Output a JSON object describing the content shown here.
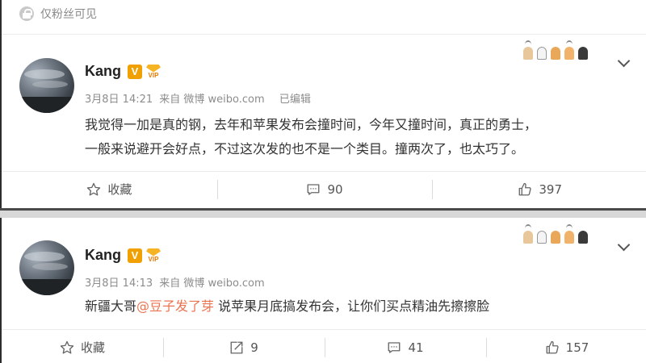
{
  "visibility": {
    "label": "仅粉丝可见"
  },
  "posts": [
    {
      "author": "Kang",
      "verified_badge": "V",
      "vip_badge": "VIP",
      "date": "3月8日 14:21",
      "source": "来自 微博 weibo.com",
      "edited": "已编辑",
      "text_line1": "我觉得一加是真的钢，去年和苹果发布会撞时间，今年又撞时间，真正的勇士，",
      "text_line2": "一般来说避开会好点，不过这次发的也不是一个类目。撞两次了，也太巧了。",
      "actions": {
        "favorite": "收藏",
        "comment": "90",
        "like": "397"
      }
    },
    {
      "author": "Kang",
      "verified_badge": "V",
      "vip_badge": "VIP",
      "date": "3月8日 14:13",
      "source": "来自 微博 weibo.com",
      "text_prefix": "新疆大哥",
      "mention": "@豆子发了芽",
      "text_suffix": " 说苹果月底搞发布会，让你们买点精油先擦擦脸",
      "actions": {
        "favorite": "收藏",
        "repost": "9",
        "comment": "41",
        "like": "157"
      }
    }
  ],
  "colors": {
    "mention": "#eb7350",
    "badge": "#f0a000",
    "muted": "#8c8c8c"
  },
  "icons": [
    "lock-icon",
    "paw-decoration",
    "chevron-down-icon",
    "star-icon",
    "comment-icon",
    "repost-icon",
    "like-icon"
  ]
}
